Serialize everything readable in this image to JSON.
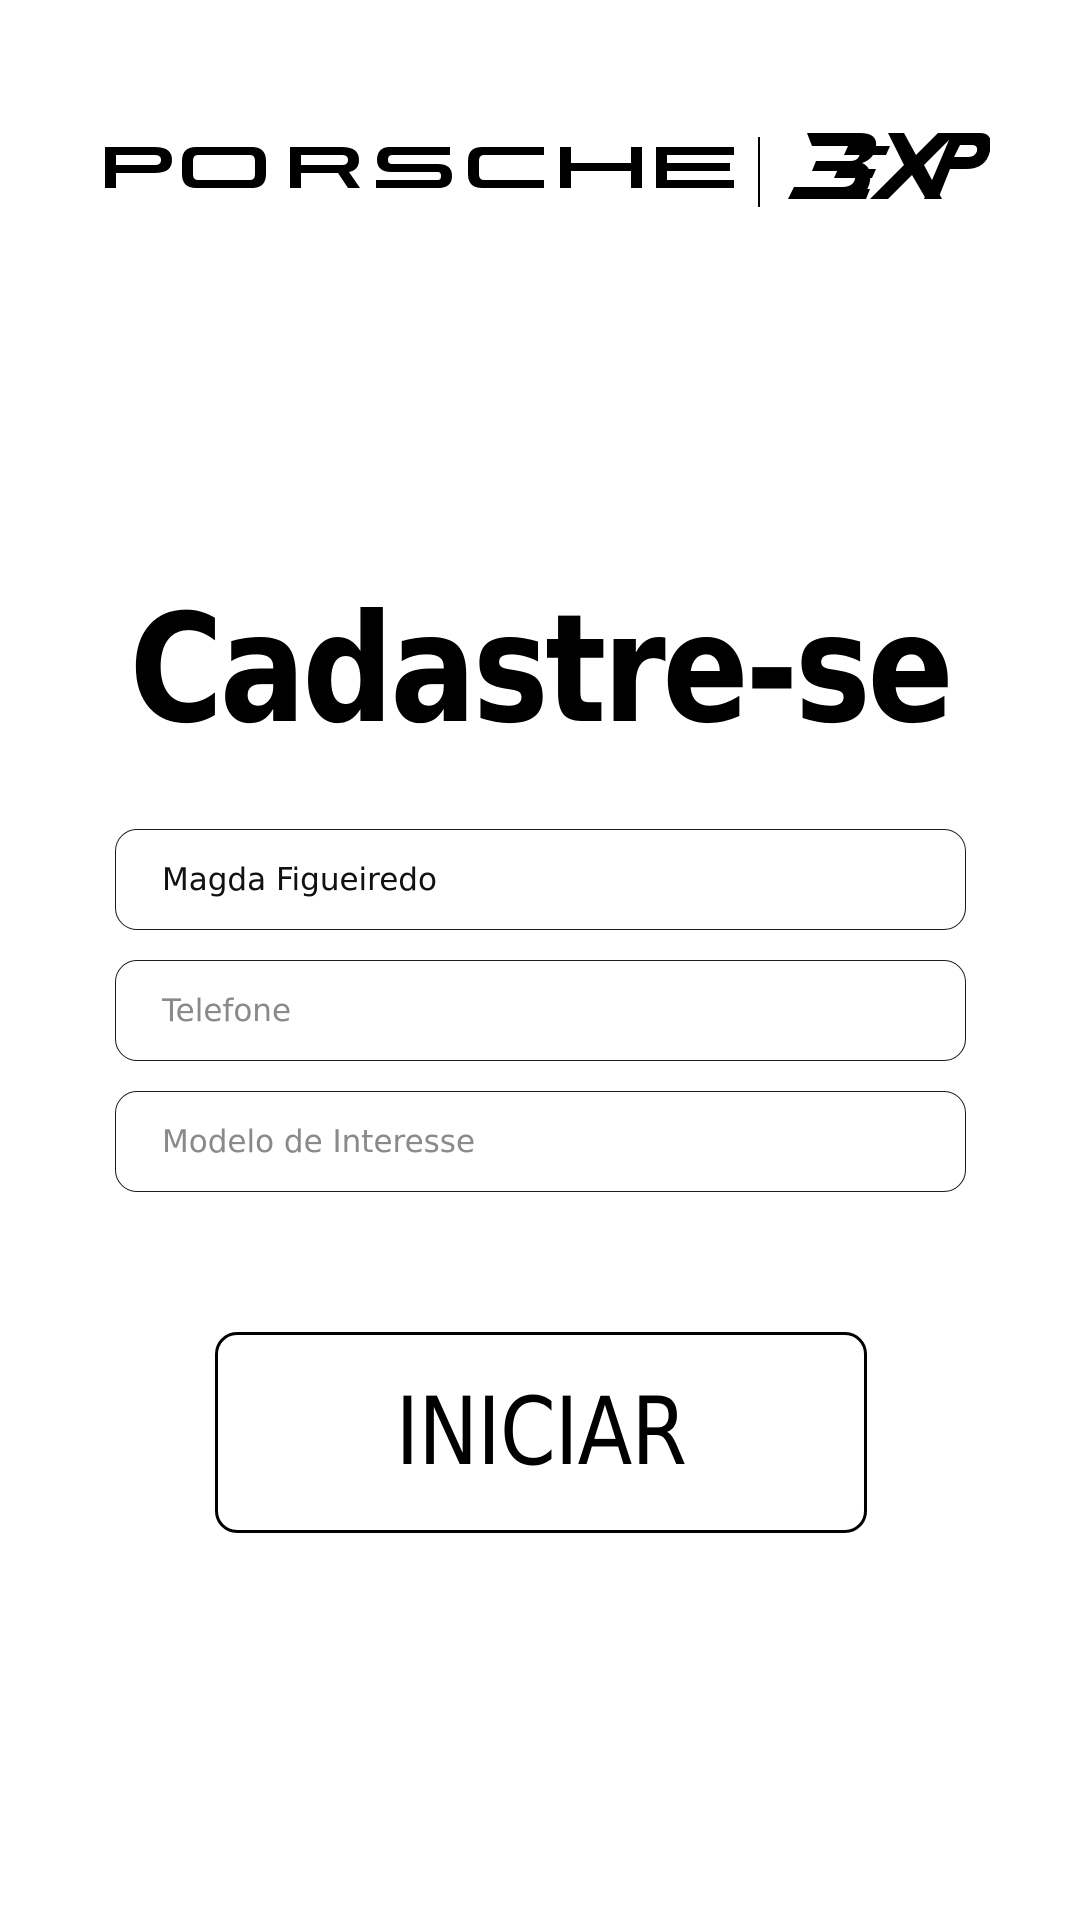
{
  "header": {
    "brand_primary": "PORSCHE",
    "brand_secondary": "BEXP"
  },
  "form": {
    "title": "Cadastre-se",
    "name_value": "Magda Figueiredo",
    "phone_placeholder": "Telefone",
    "model_placeholder": "Modelo de Interesse"
  },
  "actions": {
    "start_label": "INICIAR"
  },
  "colors": {
    "background": "#ffffff",
    "text": "#000000",
    "placeholder": "#8a8a8a",
    "border": "#1a1a1a"
  }
}
